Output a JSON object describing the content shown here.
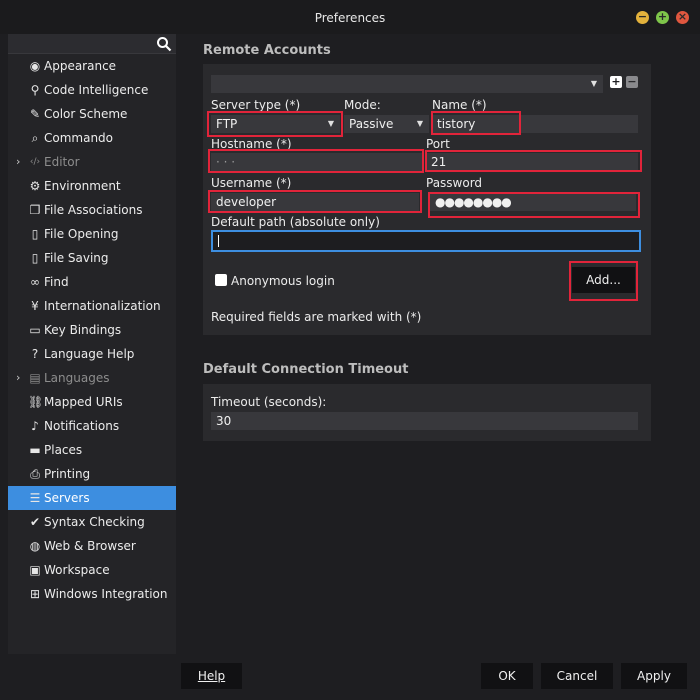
{
  "window": {
    "title": "Preferences"
  },
  "sidebar": {
    "items": [
      {
        "label": "Appearance",
        "icon": "eye-icon"
      },
      {
        "label": "Code Intelligence",
        "icon": "bulb-icon"
      },
      {
        "label": "Color Scheme",
        "icon": "brush-icon"
      },
      {
        "label": "Commando",
        "icon": "search-icon"
      },
      {
        "label": "Editor",
        "icon": "code-icon",
        "expandable": true,
        "disabled": true
      },
      {
        "label": "Environment",
        "icon": "gear-icon"
      },
      {
        "label": "File Associations",
        "icon": "file-copy-icon"
      },
      {
        "label": "File Opening",
        "icon": "file-icon"
      },
      {
        "label": "File Saving",
        "icon": "file-icon"
      },
      {
        "label": "Find",
        "icon": "binoculars-icon"
      },
      {
        "label": "Internationalization",
        "icon": "yen-icon"
      },
      {
        "label": "Key Bindings",
        "icon": "keyboard-icon"
      },
      {
        "label": "Language Help",
        "icon": "help-icon"
      },
      {
        "label": "Languages",
        "icon": "languages-icon",
        "expandable": true,
        "disabled": true
      },
      {
        "label": "Mapped URIs",
        "icon": "link-icon"
      },
      {
        "label": "Notifications",
        "icon": "bell-icon"
      },
      {
        "label": "Places",
        "icon": "folder-icon"
      },
      {
        "label": "Printing",
        "icon": "printer-icon"
      },
      {
        "label": "Servers",
        "icon": "server-icon",
        "selected": true
      },
      {
        "label": "Syntax Checking",
        "icon": "check-circle-icon"
      },
      {
        "label": "Web & Browser",
        "icon": "globe-icon"
      },
      {
        "label": "Workspace",
        "icon": "briefcase-icon"
      },
      {
        "label": "Windows Integration",
        "icon": "windows-icon"
      }
    ]
  },
  "remote": {
    "title": "Remote Accounts",
    "account_select": "",
    "server_type_label": "Server type (*)",
    "server_type_value": "FTP",
    "mode_label": "Mode:",
    "mode_value": "Passive",
    "name_label": "Name (*)",
    "name_value": "tistory",
    "hostname_label": "Hostname (*)",
    "hostname_value": "·   ·   ·",
    "port_label": "Port",
    "port_value": "21",
    "username_label": "Username (*)",
    "username_value": "developer",
    "password_label": "Password",
    "password_value": "●●●●●●●●",
    "default_path_label": "Default path (absolute only)",
    "default_path_value": "",
    "anonymous_label": "Anonymous login",
    "add_button": "Add...",
    "required_note": "Required fields are marked with (*)"
  },
  "timeout": {
    "title": "Default Connection Timeout",
    "label": "Timeout (seconds):",
    "value": "30"
  },
  "footer": {
    "help": "Help",
    "ok": "OK",
    "cancel": "Cancel",
    "apply": "Apply"
  },
  "colors": {
    "accent": "#3d8ee0",
    "highlight": "#e1243a",
    "background": "#1e1e21",
    "panel": "#2a2a2d"
  }
}
